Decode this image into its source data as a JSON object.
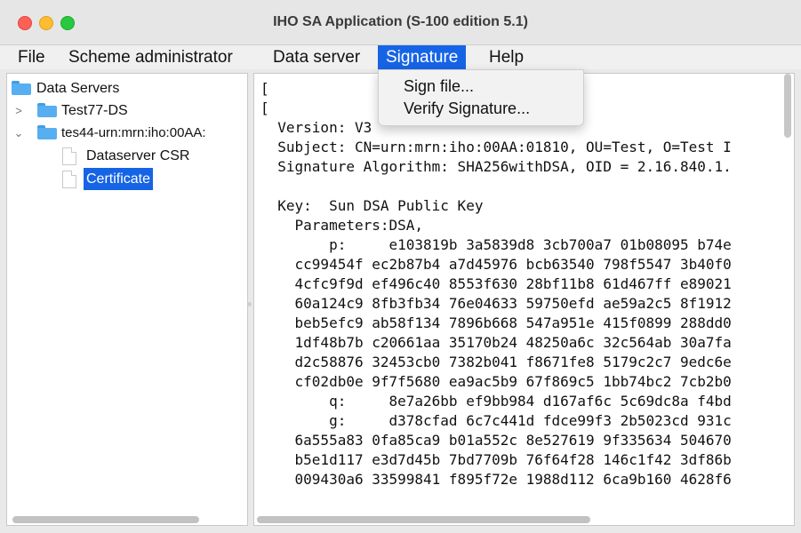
{
  "window": {
    "title": "IHO SA Application (S-100 edition 5.1)"
  },
  "menubar": {
    "items": [
      {
        "label": "File"
      },
      {
        "label": "Scheme administrator"
      },
      {
        "label": "Data server"
      },
      {
        "label": "Signature"
      },
      {
        "label": "Help"
      }
    ],
    "active": "Signature"
  },
  "signature_menu": {
    "items": [
      "Sign file...",
      "Verify Signature..."
    ]
  },
  "tree": {
    "root": "Data Servers",
    "nodes": [
      {
        "label": "Test77-DS",
        "expanded": false,
        "icon": "folder-icon"
      },
      {
        "label": "tes44-urn:mrn:iho:00AA:",
        "expanded": true,
        "icon": "folder-icon",
        "children": [
          {
            "label": "Dataserver CSR",
            "icon": "document-icon"
          },
          {
            "label": "Certificate",
            "icon": "document-icon",
            "selected": true
          }
        ]
      }
    ]
  },
  "details": {
    "lines": [
      "[",
      "[",
      "  Version: V3",
      "  Subject: CN=urn:mrn:iho:00AA:01810, OU=Test, O=Test I",
      "  Signature Algorithm: SHA256withDSA, OID = 2.16.840.1.",
      "",
      "  Key:  Sun DSA Public Key",
      "    Parameters:DSA,",
      "        p:     e103819b 3a5839d8 3cb700a7 01b08095 b74e",
      "    cc99454f ec2b87b4 a7d45976 bcb63540 798f5547 3b40f0",
      "    4cfc9f9d ef496c40 8553f630 28bf11b8 61d467ff e89021",
      "    60a124c9 8fb3fb34 76e04633 59750efd ae59a2c5 8f1912",
      "    beb5efc9 ab58f134 7896b668 547a951e 415f0899 288dd0",
      "    1df48b7b c20661aa 35170b24 48250a6c 32c564ab 30a7fa",
      "    d2c58876 32453cb0 7382b041 f8671fe8 5179c2c7 9edc6e",
      "    cf02db0e 9f7f5680 ea9ac5b9 67f869c5 1bb74bc2 7cb2b0",
      "        q:     8e7a26bb ef9bb984 d167af6c 5c69dc8a f4bd",
      "        g:     d378cfad 6c7c441d fdce99f3 2b5023cd 931c",
      "    6a555a83 0fa85ca9 b01a552c 8e527619 9f335634 504670",
      "    b5e1d117 e3d7d45b 7bd7709b 76f64f28 146c1f42 3df86b",
      "    009430a6 33599841 f895f72e 1988d112 6ca9b160 4628f6"
    ]
  },
  "colors": {
    "selection": "#1664e6",
    "folder": "#57aef0"
  }
}
